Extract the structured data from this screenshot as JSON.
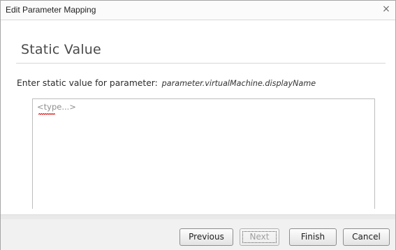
{
  "dialog": {
    "title": "Edit Parameter Mapping",
    "close_glyph": "×",
    "close_icon": "close-icon"
  },
  "section": {
    "heading": "Static Value"
  },
  "prompt": {
    "label": "Enter static value for parameter:",
    "parameter_name": "parameter.virtualMachine.displayName"
  },
  "value_input": {
    "placeholder": "<type...>",
    "value": ""
  },
  "buttons": {
    "previous": "Previous",
    "next": "Next",
    "finish": "Finish",
    "cancel": "Cancel"
  },
  "colors": {
    "spellcheck_underline": "#d40000"
  }
}
